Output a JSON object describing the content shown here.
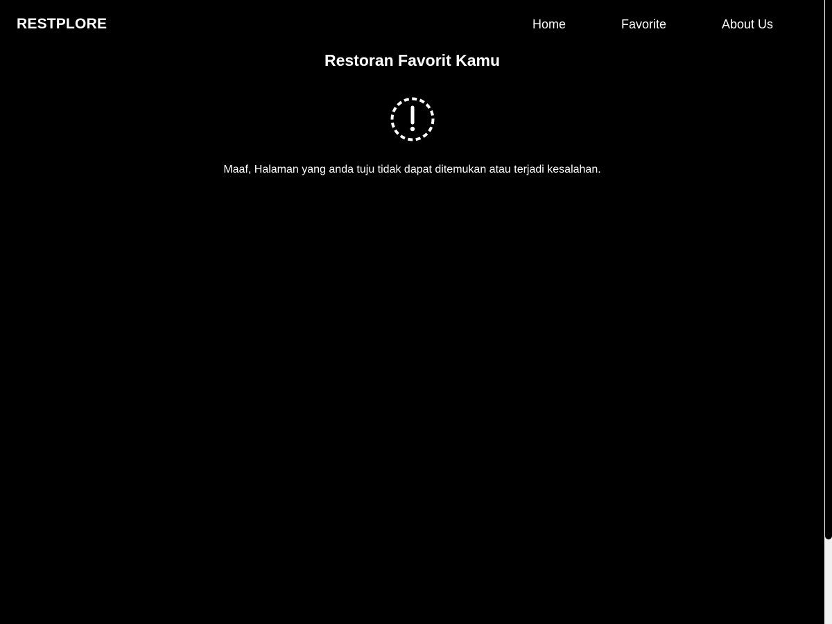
{
  "nav": {
    "brand": "RESTPLORE",
    "links": [
      "Home",
      "Favorite",
      "About Us"
    ]
  },
  "main": {
    "title": "Restoran Favorit Kamu",
    "icon": "alert-circle-icon",
    "message": "Maaf, Halaman yang anda tuju tidak dapat ditemukan atau terjadi kesalahan."
  },
  "colors": {
    "background": "#000000",
    "text": "#ffffff",
    "scrollbar_track": "#f1f1f1"
  }
}
